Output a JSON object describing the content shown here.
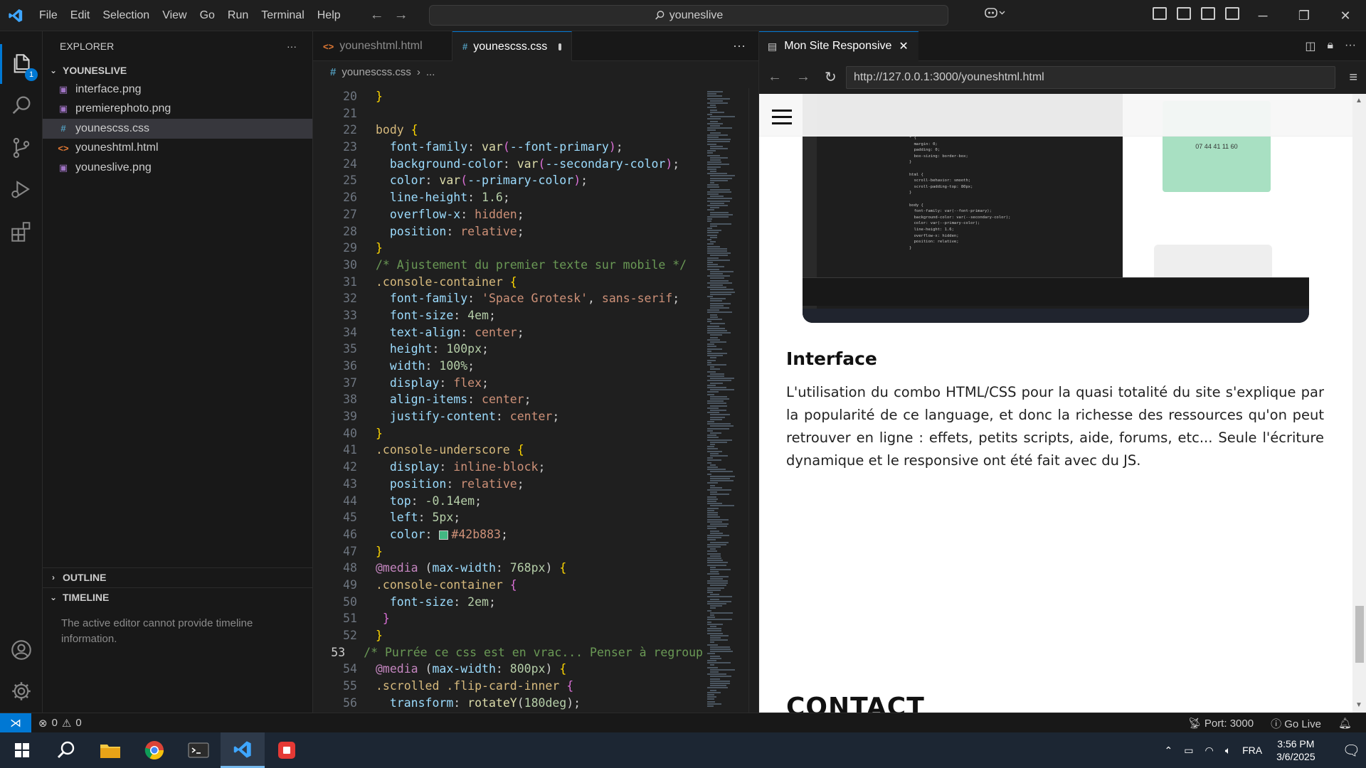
{
  "titlebar": {
    "menu": [
      "File",
      "Edit",
      "Selection",
      "View",
      "Go",
      "Run",
      "Terminal",
      "Help"
    ],
    "search_text": "youneslive"
  },
  "activitybar": {
    "explorer_badge": "1"
  },
  "explorer": {
    "title": "EXPLORER",
    "more": "···",
    "folder": "YOUNESLIVE",
    "files": [
      {
        "name": "interface.png",
        "type": "png"
      },
      {
        "name": "premierephoto.png",
        "type": "png"
      },
      {
        "name": "younescss.css",
        "type": "css",
        "selected": true
      },
      {
        "name": "youneshtml.html",
        "type": "html"
      },
      {
        "name": "youneslive.png",
        "type": "png"
      }
    ],
    "outline": "OUTLINE",
    "timeline": "TIMELINE",
    "timeline_message": "The active editor cannot provide timeline information."
  },
  "editor": {
    "tabs": [
      {
        "label": "youneshtml.html",
        "icon": "<>",
        "active": false
      },
      {
        "label": "younescss.css",
        "icon": "#",
        "active": true,
        "dirty": true
      }
    ],
    "more": "···",
    "breadcrumb_file": "younescss.css",
    "breadcrumb_more": "...",
    "current_line": 53,
    "lines": [
      {
        "n": 20,
        "s": [
          [
            "}",
            "t-br1"
          ]
        ]
      },
      {
        "n": 21,
        "s": []
      },
      {
        "n": 22,
        "s": [
          [
            "body ",
            "t-sel"
          ],
          [
            "{",
            "t-br1"
          ]
        ]
      },
      {
        "n": 23,
        "s": [
          [
            "  font-family",
            "t-prop"
          ],
          [
            ": ",
            "txt"
          ],
          [
            "var",
            "t-fn"
          ],
          [
            "(",
            "t-br2"
          ],
          [
            "--font-primary",
            "t-var"
          ],
          [
            ")",
            "t-br2"
          ],
          [
            ";",
            "txt"
          ]
        ]
      },
      {
        "n": 24,
        "s": [
          [
            "  background-color",
            "t-prop"
          ],
          [
            ": ",
            "txt"
          ],
          [
            "var",
            "t-fn"
          ],
          [
            "(",
            "t-br2"
          ],
          [
            "--secondary-color",
            "t-var"
          ],
          [
            ")",
            "t-br2"
          ],
          [
            ";",
            "txt"
          ]
        ]
      },
      {
        "n": 25,
        "s": [
          [
            "  color",
            "t-prop"
          ],
          [
            ": ",
            "txt"
          ],
          [
            "var",
            "t-fn"
          ],
          [
            "(",
            "t-br2"
          ],
          [
            "--primary-color",
            "t-var"
          ],
          [
            ")",
            "t-br2"
          ],
          [
            ";",
            "txt"
          ]
        ]
      },
      {
        "n": 26,
        "s": [
          [
            "  line-height",
            "t-prop"
          ],
          [
            ": ",
            "txt"
          ],
          [
            "1.6",
            "t-num"
          ],
          [
            ";",
            "txt"
          ]
        ]
      },
      {
        "n": 27,
        "s": [
          [
            "  overflow-x",
            "t-prop"
          ],
          [
            ": ",
            "txt"
          ],
          [
            "hidden",
            "t-val"
          ],
          [
            ";",
            "txt"
          ]
        ]
      },
      {
        "n": 28,
        "s": [
          [
            "  position",
            "t-prop"
          ],
          [
            ": ",
            "txt"
          ],
          [
            "relative",
            "t-val"
          ],
          [
            ";",
            "txt"
          ]
        ]
      },
      {
        "n": 29,
        "s": [
          [
            "}",
            "t-br1"
          ]
        ]
      },
      {
        "n": 30,
        "s": [
          [
            "/* Ajustement du premier texte sur mobile */",
            "t-cmt"
          ]
        ]
      },
      {
        "n": 31,
        "s": [
          [
            ".console-container ",
            "t-sel"
          ],
          [
            "{",
            "t-br1"
          ]
        ]
      },
      {
        "n": 32,
        "s": [
          [
            "  font-family",
            "t-prop"
          ],
          [
            ": ",
            "txt"
          ],
          [
            "'Space Grotesk'",
            "t-val"
          ],
          [
            ", ",
            "txt"
          ],
          [
            "sans-serif",
            "t-val"
          ],
          [
            ";",
            "txt"
          ]
        ]
      },
      {
        "n": 33,
        "s": [
          [
            "  font-size",
            "t-prop"
          ],
          [
            ": ",
            "txt"
          ],
          [
            "4em",
            "t-num"
          ],
          [
            ";",
            "txt"
          ]
        ]
      },
      {
        "n": 34,
        "s": [
          [
            "  text-align",
            "t-prop"
          ],
          [
            ": ",
            "txt"
          ],
          [
            "center",
            "t-val"
          ],
          [
            ";",
            "txt"
          ]
        ]
      },
      {
        "n": 35,
        "s": [
          [
            "  height",
            "t-prop"
          ],
          [
            ": ",
            "txt"
          ],
          [
            "100px",
            "t-num"
          ],
          [
            ";",
            "txt"
          ]
        ]
      },
      {
        "n": 36,
        "s": [
          [
            "  width",
            "t-prop"
          ],
          [
            ": ",
            "txt"
          ],
          [
            "100%",
            "t-num"
          ],
          [
            ";",
            "txt"
          ]
        ]
      },
      {
        "n": 37,
        "s": [
          [
            "  display",
            "t-prop"
          ],
          [
            ": ",
            "txt"
          ],
          [
            "flex",
            "t-val"
          ],
          [
            ";",
            "txt"
          ]
        ]
      },
      {
        "n": 38,
        "s": [
          [
            "  align-items",
            "t-prop"
          ],
          [
            ": ",
            "txt"
          ],
          [
            "center",
            "t-val"
          ],
          [
            ";",
            "txt"
          ]
        ]
      },
      {
        "n": 39,
        "s": [
          [
            "  justify-content",
            "t-prop"
          ],
          [
            ": ",
            "txt"
          ],
          [
            "center",
            "t-val"
          ],
          [
            ";",
            "txt"
          ]
        ]
      },
      {
        "n": 40,
        "s": [
          [
            "}",
            "t-br1"
          ]
        ]
      },
      {
        "n": 41,
        "s": [
          [
            ".console-underscore ",
            "t-sel"
          ],
          [
            "{",
            "t-br1"
          ]
        ]
      },
      {
        "n": 42,
        "s": [
          [
            "  display",
            "t-prop"
          ],
          [
            ": ",
            "txt"
          ],
          [
            "inline-block",
            "t-val"
          ],
          [
            ";",
            "txt"
          ]
        ]
      },
      {
        "n": 43,
        "s": [
          [
            "  position",
            "t-prop"
          ],
          [
            ": ",
            "txt"
          ],
          [
            "relative",
            "t-val"
          ],
          [
            ";",
            "txt"
          ]
        ]
      },
      {
        "n": 44,
        "s": [
          [
            "  top",
            "t-prop"
          ],
          [
            ": ",
            "txt"
          ],
          [
            "-0.14em",
            "t-num"
          ],
          [
            ";",
            "txt"
          ]
        ]
      },
      {
        "n": 45,
        "s": [
          [
            "  left",
            "t-prop"
          ],
          [
            ": ",
            "txt"
          ],
          [
            "5px",
            "t-num"
          ],
          [
            ";",
            "txt"
          ]
        ]
      },
      {
        "n": 46,
        "s": [
          [
            "  color",
            "t-prop"
          ],
          [
            ": ",
            "txt"
          ],
          [
            "#SWATCH#",
            "swatch"
          ],
          [
            "#42b883",
            "t-val"
          ],
          [
            ";",
            "txt"
          ]
        ]
      },
      {
        "n": 47,
        "s": [
          [
            "}",
            "t-br1"
          ]
        ]
      },
      {
        "n": 48,
        "s": [
          [
            "@media",
            "t-at"
          ],
          [
            " (",
            "txt"
          ],
          [
            "max-width",
            "t-prop"
          ],
          [
            ": ",
            "txt"
          ],
          [
            "768px",
            "t-num"
          ],
          [
            ") ",
            "txt"
          ],
          [
            "{",
            "t-br1"
          ]
        ]
      },
      {
        "n": 49,
        "s": [
          [
            ".console-container ",
            "t-sel"
          ],
          [
            "{",
            "t-br2"
          ]
        ]
      },
      {
        "n": 50,
        "s": [
          [
            "  font-size",
            "t-prop"
          ],
          [
            ": ",
            "txt"
          ],
          [
            "2em",
            "t-num"
          ],
          [
            ";",
            "txt"
          ]
        ]
      },
      {
        "n": 51,
        "s": [
          [
            " }",
            "t-br2"
          ]
        ]
      },
      {
        "n": 52,
        "s": [
          [
            "}",
            "t-br1"
          ]
        ]
      },
      {
        "n": 53,
        "s": [
          [
            "/* Purrée ce css est en vrac... Penser à regroup",
            "t-cmt"
          ]
        ]
      },
      {
        "n": 54,
        "s": [
          [
            "@media",
            "t-at"
          ],
          [
            " (",
            "txt"
          ],
          [
            "max-width",
            "t-prop"
          ],
          [
            ": ",
            "txt"
          ],
          [
            "800px",
            "t-num"
          ],
          [
            ") ",
            "txt"
          ],
          [
            "{",
            "t-br1"
          ]
        ]
      },
      {
        "n": 55,
        "s": [
          [
            ".scrolled .flip-card-inner ",
            "t-sel"
          ],
          [
            "{",
            "t-br2"
          ]
        ]
      },
      {
        "n": 56,
        "s": [
          [
            "  transform",
            "t-prop"
          ],
          [
            ": ",
            "txt"
          ],
          [
            "rotateY",
            "t-fn"
          ],
          [
            "(",
            "txt"
          ],
          [
            "180deg",
            "t-num"
          ],
          [
            ");",
            "txt"
          ]
        ]
      }
    ],
    "swatch_color": "#42b883"
  },
  "browser": {
    "tab_title": "Mon Site Responsive",
    "url": "http://127.0.0.1:3000/youneshtml.html",
    "screenshot_card_text": "07 44 41 11 60",
    "interface_title": "Interface",
    "interface_text": "L'utilisation du combo HTML/CSS pour la quasi totalité du site s'explique par la popularité de ce language, et donc la richesse des ressources qu'on peut retrouver en ligne : effets, petits scripts, aide, forums, etc... Seule l'écriture dynamique et le responsive ont été fait avec du JS.",
    "contact_title": "CONTACT"
  },
  "statusbar": {
    "errors": "0",
    "warnings": "0",
    "port": "Port: 3000",
    "golive": "Go Live"
  },
  "taskbar": {
    "lang": "FRA",
    "time": "3:56 PM",
    "date": "3/6/2025"
  }
}
